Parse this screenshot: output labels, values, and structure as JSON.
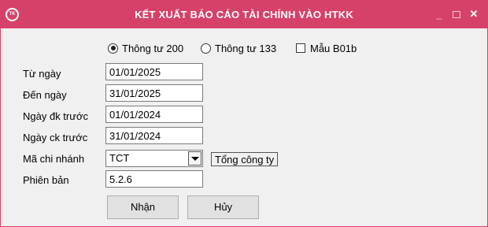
{
  "window": {
    "title": "KẾT XUẤT BÁO CÁO TÀI CHÍNH VÀO HTKK",
    "icon_text": "TK",
    "minimize_glyph": "_",
    "close_glyph": "✕"
  },
  "options": {
    "circular_200": {
      "label": "Thông tư 200",
      "selected": true
    },
    "circular_133": {
      "label": "Thông tư 133",
      "selected": false
    },
    "form_b01b": {
      "label": "Mẫu B01b",
      "checked": false
    }
  },
  "form": {
    "from_date": {
      "label": "Từ ngày",
      "value": "01/01/2025"
    },
    "to_date": {
      "label": "Đến ngày",
      "value": "31/01/2025"
    },
    "prev_start_date": {
      "label": "Ngày đk trước",
      "value": "01/01/2024"
    },
    "prev_end_date": {
      "label": "Ngày ck trước",
      "value": "31/01/2024"
    },
    "branch_code": {
      "label": "Mã chi nhánh",
      "value": "TCT",
      "branch_name": "Tổng công ty"
    },
    "version": {
      "label": "Phiên bản",
      "value": "5.2.6"
    }
  },
  "buttons": {
    "ok": "Nhận",
    "cancel": "Hủy"
  },
  "colors": {
    "titlebar": "#d6416a",
    "window_bg": "#f0f0f0"
  }
}
